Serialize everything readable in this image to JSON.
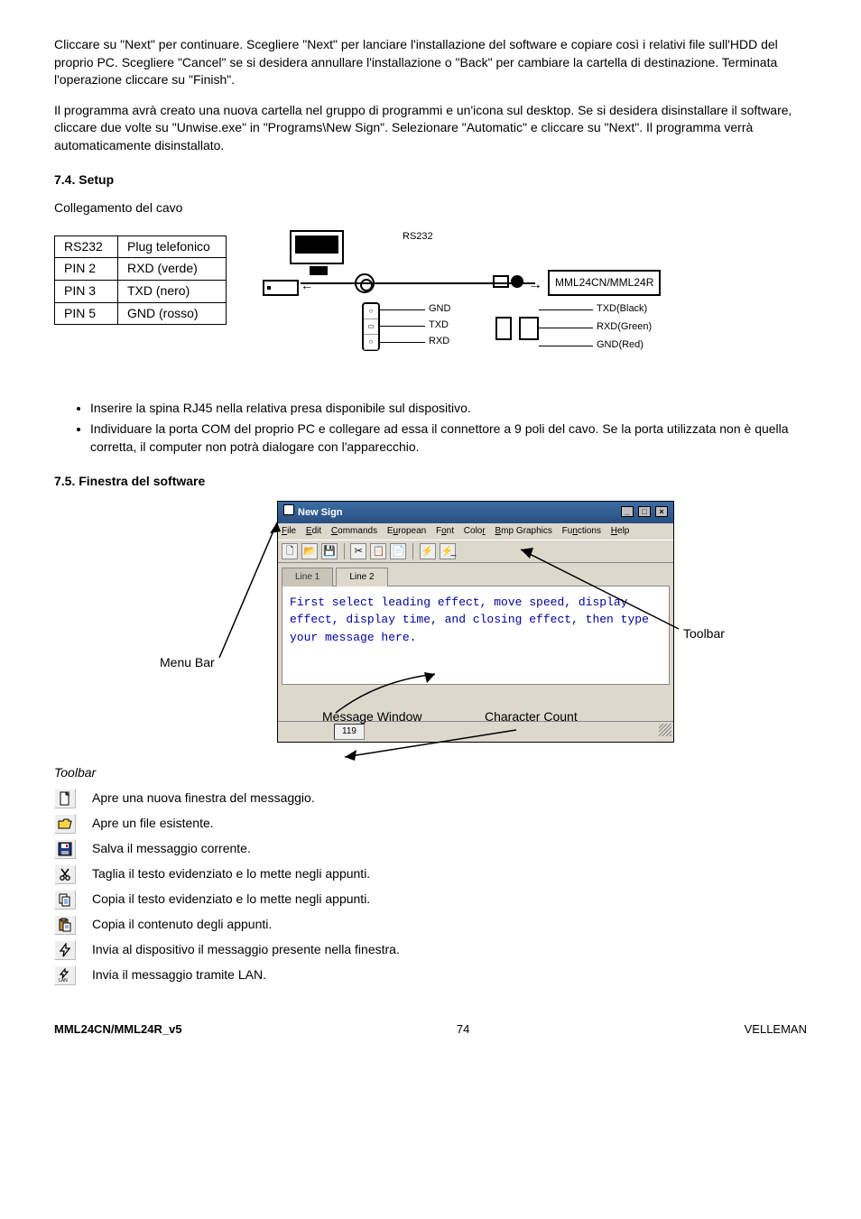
{
  "paragraphs": {
    "p1": "Cliccare su \"Next\" per continuare. Scegliere \"Next\" per lanciare l'installazione del software e copiare così i relativi file sull'HDD del proprio PC. Scegliere \"Cancel\" se si desidera annullare l'installazione o \"Back\" per cambiare la cartella di destinazione. Terminata l'operazione cliccare su \"Finish\".",
    "p2": "Il programma avrà creato una nuova cartella nel gruppo di programmi e un'icona sul desktop. Se si desidera disinstallare il software, cliccare due volte su \"Unwise.exe\" in \"Programs\\New Sign\". Selezionare \"Automatic\" e cliccare su \"Next\". Il programma verrà automaticamente disinstallato."
  },
  "sections": {
    "setup": "7.4.   Setup",
    "cable_intro": "Collegamento del cavo",
    "software": "7.5.   Finestra del software"
  },
  "pin_table": {
    "rows": [
      [
        "RS232",
        "Plug telefonico"
      ],
      [
        "PIN 2",
        "RXD (verde)"
      ],
      [
        "PIN 3",
        "TXD (nero)"
      ],
      [
        "PIN 5",
        "GND (rosso)"
      ]
    ]
  },
  "cable_diagram": {
    "rs232": "RS232",
    "device": "MML24CN/MML24R",
    "gnd": "GND",
    "txd": "TXD",
    "rxd": "RXD",
    "txd_black": "TXD(Black)",
    "rxd_green": "RXD(Green)",
    "gnd_red": "GND(Red)"
  },
  "bullets": {
    "b1": "Inserire la spina RJ45 nella relativa presa disponibile sul dispositivo.",
    "b2": "Individuare la porta COM del proprio PC e collegare ad essa il connettore a 9 poli del cavo. Se la porta utilizzata non è quella corretta, il computer non potrà dialogare con l'apparecchio."
  },
  "software_window": {
    "title": "New Sign",
    "menu": {
      "file": "File",
      "edit": "Edit",
      "commands": "Commands",
      "european": "European",
      "font": "Font",
      "color": "Color",
      "bmp": "Bmp Graphics",
      "functions": "Functions",
      "help": "Help"
    },
    "tab1": "Line 1",
    "tab2": "Line 2",
    "message": "First select leading effect, move speed, display effect, display time, and closing effect, then type your message here.",
    "char_count": "119"
  },
  "annotations": {
    "menu_bar": "Menu Bar",
    "toolbar": "Toolbar",
    "message_window": "Message Window",
    "character_count": "Character Count"
  },
  "toolbar_section": {
    "heading": "Toolbar",
    "rows": [
      {
        "icon": "new",
        "text": "Apre una nuova finestra del messaggio."
      },
      {
        "icon": "open",
        "text": "Apre un file esistente."
      },
      {
        "icon": "save",
        "text": "Salva il messaggio corrente."
      },
      {
        "icon": "cut",
        "text": "Taglia il testo evidenziato e lo mette negli appunti."
      },
      {
        "icon": "copy",
        "text": "Copia il testo evidenziato e lo mette negli appunti."
      },
      {
        "icon": "paste",
        "text": "Copia il contenuto degli appunti."
      },
      {
        "icon": "send",
        "text": "Invia al dispositivo il messaggio presente nella finestra."
      },
      {
        "icon": "lan",
        "text": "Invia il messaggio tramite LAN."
      }
    ]
  },
  "footer": {
    "left": "MML24CN/MML24R_v5",
    "center": "74",
    "right": "VELLEMAN"
  }
}
